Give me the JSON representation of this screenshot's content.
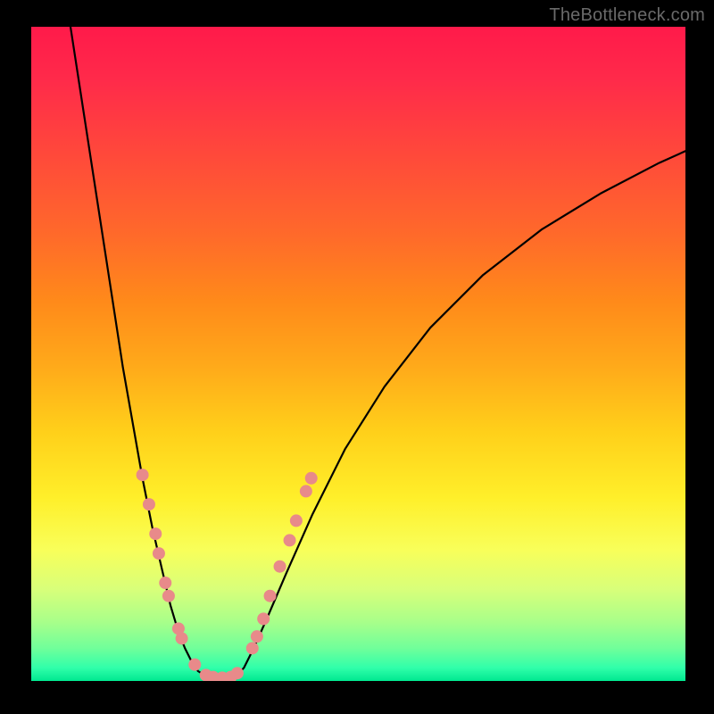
{
  "watermark": "TheBottleneck.com",
  "chart_data": {
    "type": "line",
    "title": "",
    "xlabel": "",
    "ylabel": "",
    "xlim": [
      0,
      1
    ],
    "ylim": [
      0,
      1
    ],
    "series": [
      {
        "name": "left-curve",
        "x": [
          0.06,
          0.08,
          0.1,
          0.12,
          0.14,
          0.155,
          0.17,
          0.185,
          0.2,
          0.213,
          0.225,
          0.235,
          0.245,
          0.255,
          0.268
        ],
        "y": [
          1.0,
          0.87,
          0.74,
          0.61,
          0.48,
          0.395,
          0.31,
          0.235,
          0.17,
          0.115,
          0.075,
          0.05,
          0.03,
          0.015,
          0.007
        ]
      },
      {
        "name": "left-curve-flat",
        "x": [
          0.268,
          0.28,
          0.295,
          0.31
        ],
        "y": [
          0.007,
          0.003,
          0.003,
          0.005
        ]
      },
      {
        "name": "right-curve",
        "x": [
          0.31,
          0.325,
          0.34,
          0.36,
          0.39,
          0.43,
          0.48,
          0.54,
          0.61,
          0.69,
          0.78,
          0.87,
          0.96,
          1.0
        ],
        "y": [
          0.005,
          0.02,
          0.05,
          0.095,
          0.165,
          0.255,
          0.355,
          0.45,
          0.54,
          0.62,
          0.69,
          0.745,
          0.792,
          0.81
        ]
      }
    ],
    "markers": {
      "name": "marker-dots",
      "color": "#e88a8a",
      "radius_px": 7,
      "points": [
        {
          "x": 0.17,
          "y": 0.315
        },
        {
          "x": 0.18,
          "y": 0.27
        },
        {
          "x": 0.19,
          "y": 0.225
        },
        {
          "x": 0.195,
          "y": 0.195
        },
        {
          "x": 0.205,
          "y": 0.15
        },
        {
          "x": 0.21,
          "y": 0.13
        },
        {
          "x": 0.225,
          "y": 0.08
        },
        {
          "x": 0.23,
          "y": 0.065
        },
        {
          "x": 0.25,
          "y": 0.025
        },
        {
          "x": 0.267,
          "y": 0.009
        },
        {
          "x": 0.278,
          "y": 0.006
        },
        {
          "x": 0.292,
          "y": 0.005
        },
        {
          "x": 0.305,
          "y": 0.006
        },
        {
          "x": 0.315,
          "y": 0.012
        },
        {
          "x": 0.338,
          "y": 0.05
        },
        {
          "x": 0.345,
          "y": 0.068
        },
        {
          "x": 0.355,
          "y": 0.095
        },
        {
          "x": 0.365,
          "y": 0.13
        },
        {
          "x": 0.38,
          "y": 0.175
        },
        {
          "x": 0.395,
          "y": 0.215
        },
        {
          "x": 0.405,
          "y": 0.245
        },
        {
          "x": 0.42,
          "y": 0.29
        },
        {
          "x": 0.428,
          "y": 0.31
        }
      ]
    }
  }
}
